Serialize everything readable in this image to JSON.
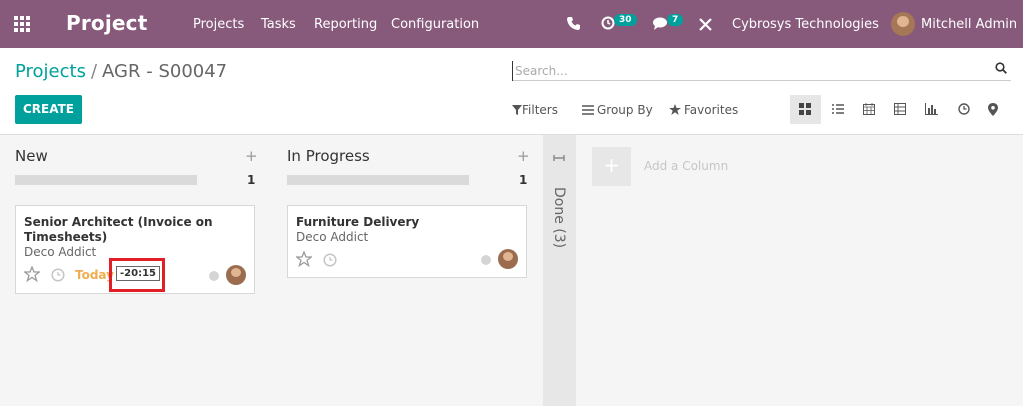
{
  "navbar": {
    "brand": "Project",
    "menu": [
      "Projects",
      "Tasks",
      "Reporting",
      "Configuration"
    ],
    "activity_count": "30",
    "message_count": "7",
    "company": "Cybrosys Technologies",
    "user": "Mitchell Admin",
    "icons": [
      "apps-grid-icon",
      "phone-icon",
      "clock-activity-icon",
      "chat-icon",
      "debug-tool-icon"
    ]
  },
  "breadcrumb": {
    "parent": "Projects",
    "separator": "/",
    "current": "AGR - S00047"
  },
  "search": {
    "placeholder": "Search..."
  },
  "toolbar": {
    "create": "CREATE",
    "filters": "Filters",
    "group_by": "Group By",
    "favorites": "Favorites",
    "views": [
      "kanban",
      "list",
      "calendar",
      "pivot",
      "graph",
      "activity",
      "map"
    ],
    "active_view": "kanban"
  },
  "columns": [
    {
      "title": "New",
      "count": "1",
      "cards": [
        {
          "title": "Senior Architect (Invoice on Timesheets)",
          "customer": "Deco Addict",
          "deadline": "Today",
          "timer": "-20:15"
        }
      ]
    },
    {
      "title": "In Progress",
      "count": "1",
      "cards": [
        {
          "title": "Furniture Delivery",
          "customer": "Deco Addict"
        }
      ]
    }
  ],
  "folded_column": {
    "label": "Done (3)"
  },
  "add_column": {
    "label": "Add a Column",
    "symbol": "+"
  },
  "plus_symbol": "+",
  "colors": {
    "navbar": "#875a7b",
    "accent": "#00a09d",
    "today": "#f0ad4e",
    "highlight": "#e21f26"
  }
}
